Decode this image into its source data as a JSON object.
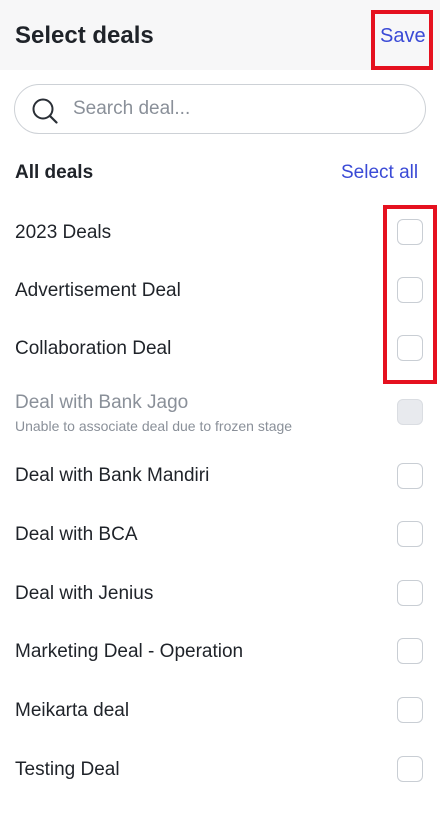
{
  "header": {
    "title": "Select deals",
    "save_label": "Save"
  },
  "search": {
    "placeholder": "Search deal...",
    "value": ""
  },
  "list": {
    "section_label": "All deals",
    "select_all_label": "Select all",
    "deals": [
      {
        "label": "2023 Deals",
        "checked": false,
        "disabled": false
      },
      {
        "label": "Advertisement Deal",
        "checked": false,
        "disabled": false
      },
      {
        "label": "Collaboration Deal",
        "checked": false,
        "disabled": false
      },
      {
        "label": "Deal with Bank Jago",
        "sub": "Unable to associate deal due to frozen stage",
        "checked": false,
        "disabled": true
      },
      {
        "label": "Deal with Bank Mandiri",
        "checked": false,
        "disabled": false
      },
      {
        "label": "Deal with BCA",
        "checked": false,
        "disabled": false
      },
      {
        "label": "Deal with Jenius",
        "checked": false,
        "disabled": false
      },
      {
        "label": "Marketing Deal - Operation",
        "checked": false,
        "disabled": false
      },
      {
        "label": "Meikarta deal",
        "checked": false,
        "disabled": false
      },
      {
        "label": "Testing Deal",
        "checked": false,
        "disabled": false
      }
    ]
  },
  "colors": {
    "accent": "#3a4ad6",
    "highlight_box": "#e5111f",
    "text_primary": "#1f2329",
    "text_muted": "#8a9099"
  },
  "icons": {
    "search": "search-icon"
  }
}
